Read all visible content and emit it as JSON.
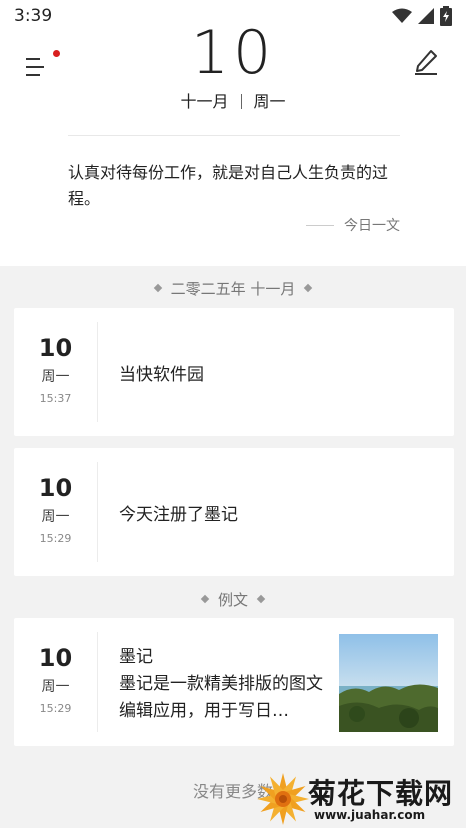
{
  "status": {
    "time": "3:39"
  },
  "header": {
    "day": "10",
    "month": "十一月",
    "weekday": "周一",
    "quote": "认真对待每份工作，就是对自己人生负责的过程。",
    "quote_source": "今日一文"
  },
  "section_month": "二零二五年 十一月",
  "entries": [
    {
      "day": "10",
      "weekday": "周一",
      "time": "15:37",
      "text": "当快软件园"
    },
    {
      "day": "10",
      "weekday": "周一",
      "time": "15:29",
      "text": "今天注册了墨记"
    }
  ],
  "section_example": "例文",
  "example": {
    "day": "10",
    "weekday": "周一",
    "time": "15:29",
    "title": "墨记",
    "body": "墨记是一款精美排版的图文编辑应用，用于写日…"
  },
  "footer": "没有更多数",
  "watermark": {
    "brand": "菊花下载网",
    "url": "www.juahar.com"
  }
}
